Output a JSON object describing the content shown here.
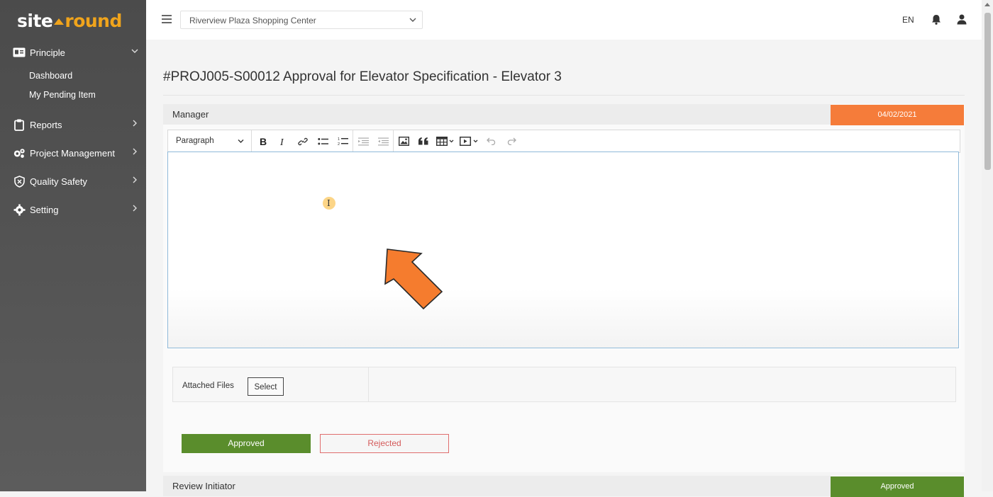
{
  "brand": {
    "left": "site",
    "right": "round"
  },
  "sidebar": {
    "principle": "Principle",
    "sub_items": [
      "Dashboard",
      "My Pending Item"
    ],
    "items": [
      {
        "label": "Reports",
        "icon": "clipboard-icon"
      },
      {
        "label": "Project Management",
        "icon": "gears-icon"
      },
      {
        "label": "Quality Safety",
        "icon": "shield-icon"
      },
      {
        "label": "Setting",
        "icon": "gear-icon"
      }
    ]
  },
  "topbar": {
    "project": "Riverview Plaza Shopping Center",
    "language": "EN"
  },
  "page": {
    "title": "#PROJ005-S00012 Approval for Elevator Specification - Elevator 3"
  },
  "manager_section": {
    "title": "Manager",
    "date": "04/02/2021",
    "editor": {
      "block_format": "Paragraph"
    },
    "attached_files_label": "Attached Files",
    "select_label": "Select",
    "approve_label": "Approved",
    "reject_label": "Rejected"
  },
  "review_section": {
    "title": "Review Initiator",
    "status": "Approved"
  },
  "colors": {
    "accent_orange": "#f57c3a",
    "approve_green": "#5a8d2c",
    "reject_red": "#d45b5b",
    "brand_orange": "#f0a41c"
  }
}
